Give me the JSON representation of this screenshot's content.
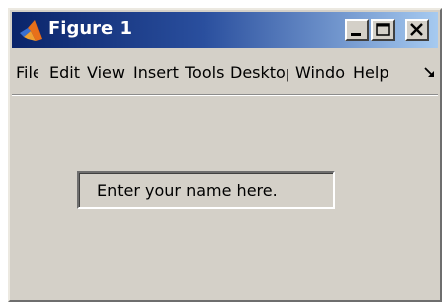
{
  "window": {
    "title": "Figure 1",
    "icon": "matlab-logo-icon"
  },
  "title_buttons": {
    "minimize_icon": "minimize-icon",
    "maximize_icon": "maximize-icon",
    "close_icon": "close-icon"
  },
  "menu": {
    "items": [
      {
        "label": "File"
      },
      {
        "label": "Edit"
      },
      {
        "label": "View"
      },
      {
        "label": "Insert"
      },
      {
        "label": "Tools"
      },
      {
        "label": "Desktop"
      },
      {
        "label": "Window"
      },
      {
        "label": "Help"
      }
    ],
    "overflow_icon": "dock-arrow-icon"
  },
  "edit_field": {
    "value": "Enter your name here."
  },
  "colors": {
    "title_gradient_start": "#0a246a",
    "title_gradient_end": "#a6caf0",
    "face": "#d4d0c8"
  }
}
